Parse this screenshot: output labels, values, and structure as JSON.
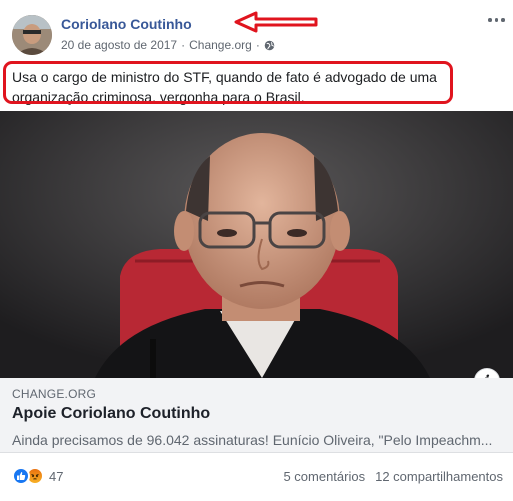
{
  "post": {
    "author": "Coriolano Coutinho",
    "date": "20 de agosto de 2017",
    "separator": "·",
    "source": "Change.org",
    "text": "Usa o cargo de ministro do STF, quando de fato é advogado de uma organização criminosa. vergonha para o Brasil."
  },
  "link": {
    "domain": "CHANGE.ORG",
    "title": "Apoie Coriolano Coutinho",
    "description": "Ainda precisamos de 96.042 assinaturas! Eunício Oliveira, \"Pelo Impeachm..."
  },
  "footer": {
    "reaction_count": "47",
    "comments": "5 comentários",
    "shares": "12 compartilhamentos"
  },
  "colors": {
    "author_link": "#385898",
    "annotation_red": "#e0141e",
    "like_blue": "#1877f2"
  }
}
